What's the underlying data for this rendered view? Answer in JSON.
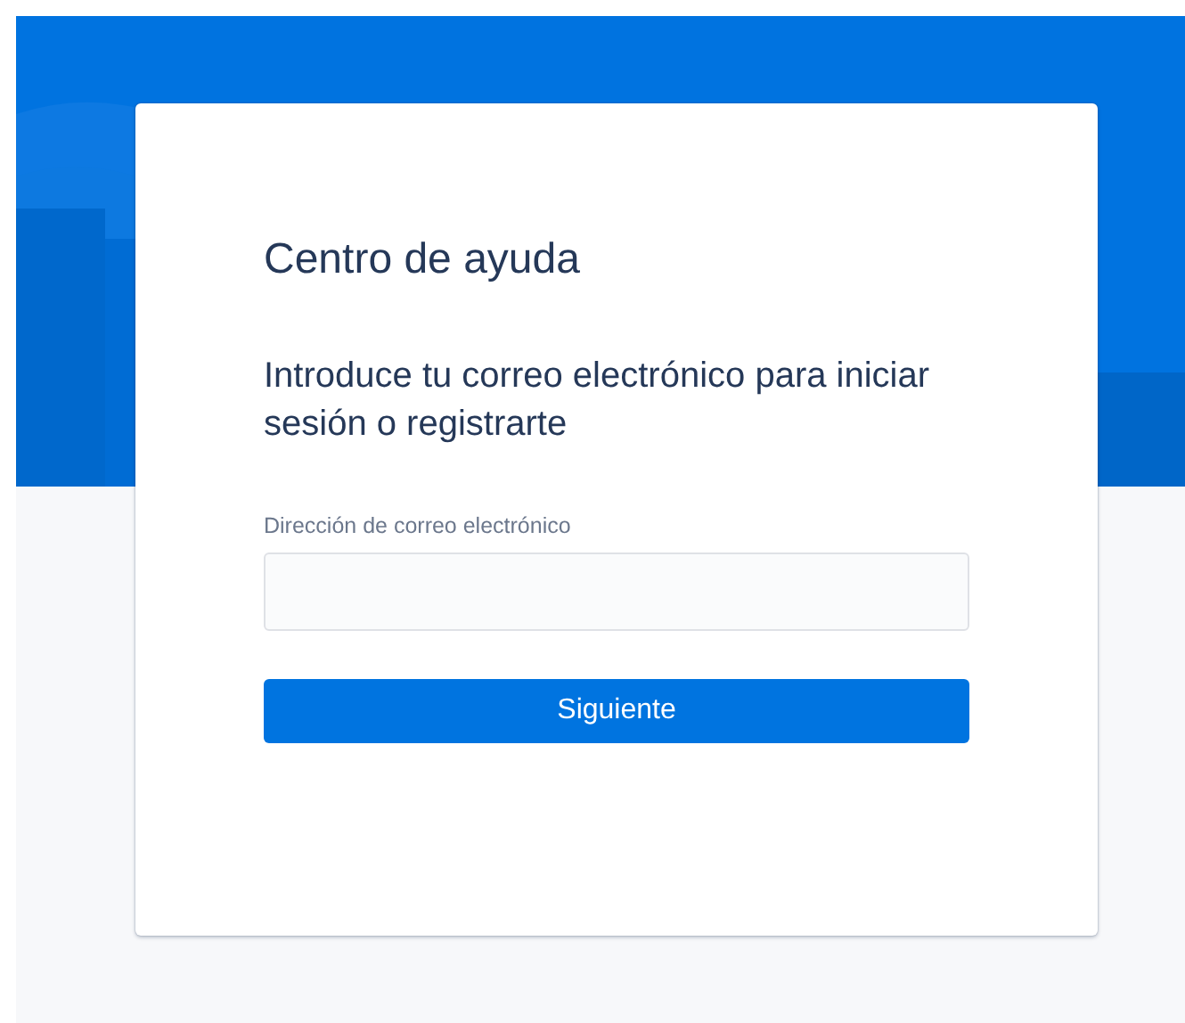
{
  "title": "Centro de ayuda",
  "prompt": "Introduce tu correo electrónico para iniciar sesión o registrarte",
  "email_field": {
    "label": "Dirección de correo electrónico"
  },
  "buttons": [
    "Siguiente"
  ]
}
